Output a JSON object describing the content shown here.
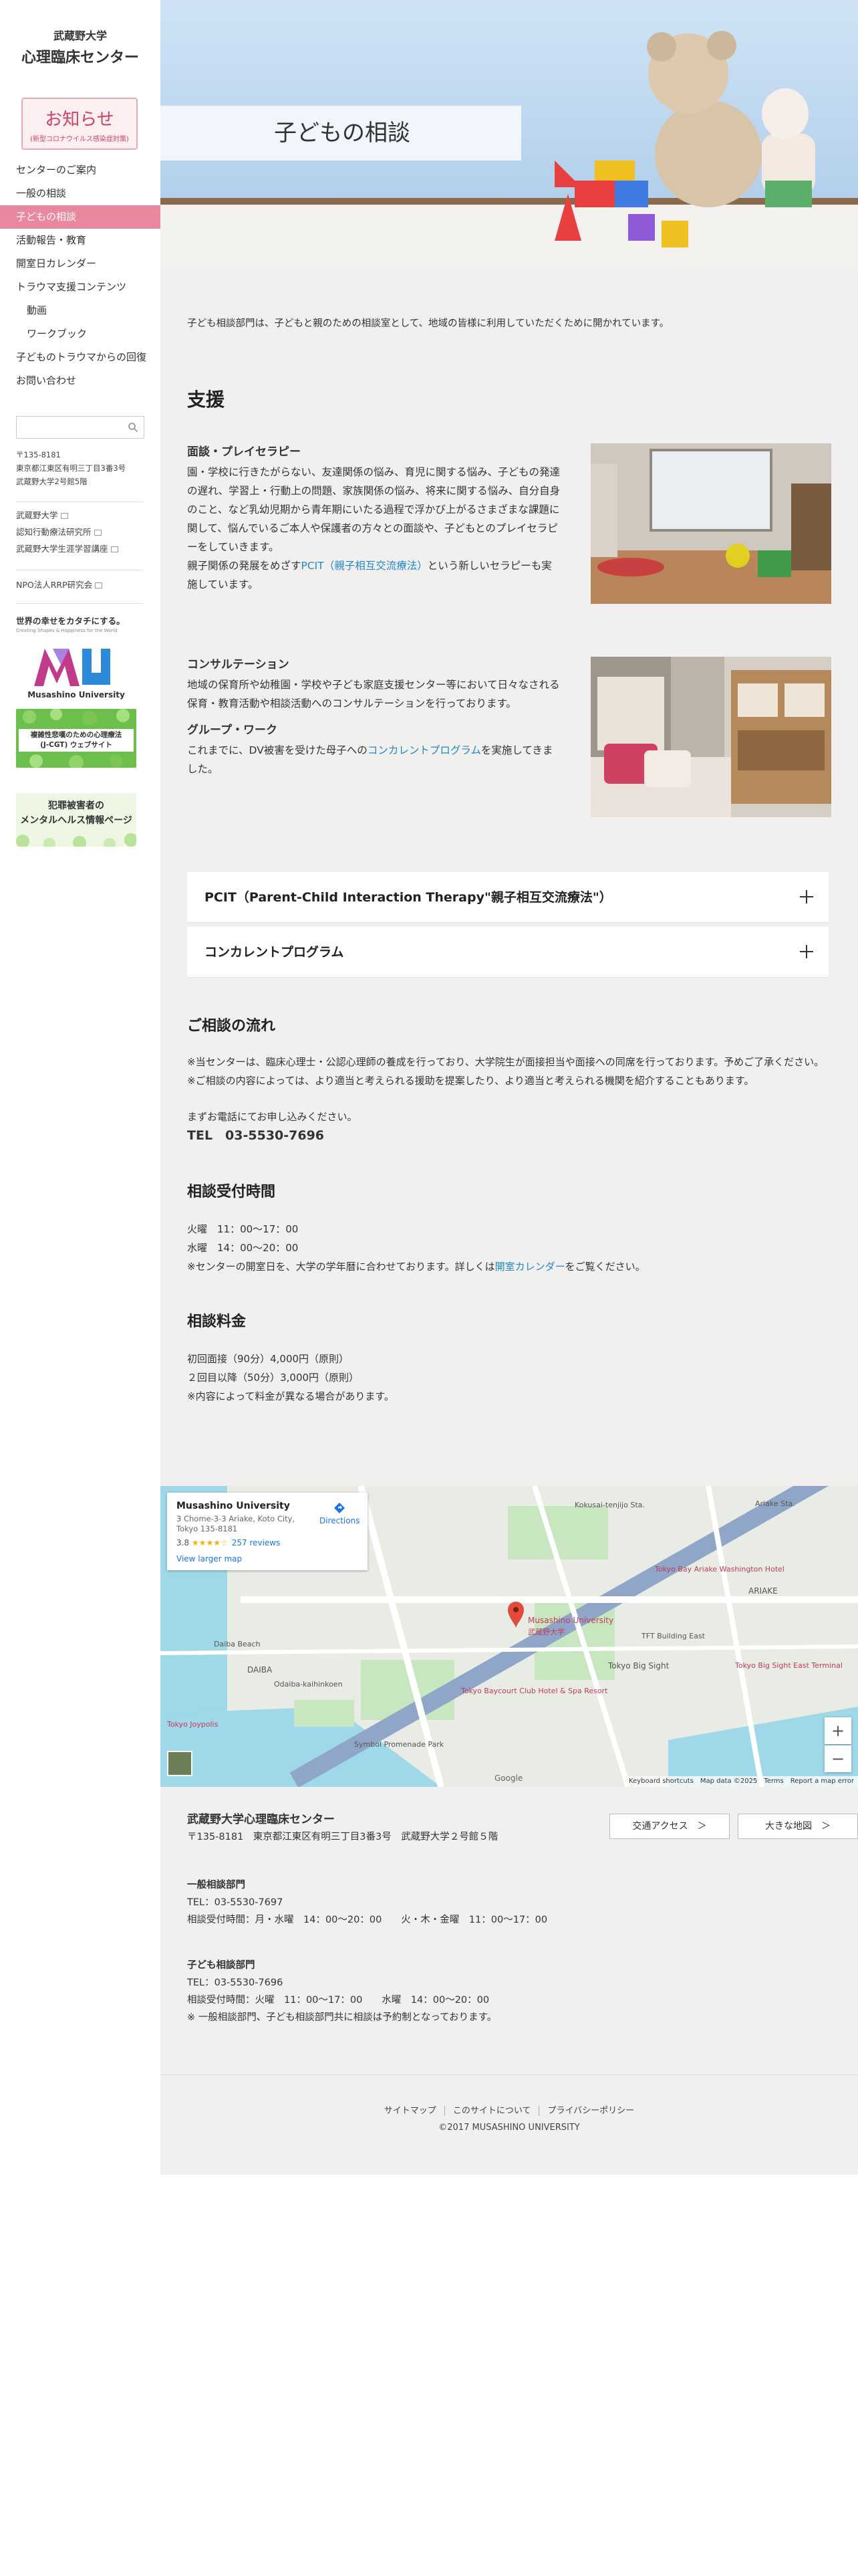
{
  "logo": {
    "university": "武蔵野大学",
    "center": "心理臨床センター"
  },
  "notice": {
    "title": "お知らせ",
    "subtitle": "(新型コロナウイルス感染症対策)"
  },
  "nav": [
    {
      "label": "センターのご案内"
    },
    {
      "label": "一般の相談"
    },
    {
      "label": "子どもの相談"
    },
    {
      "label": "活動報告・教育"
    },
    {
      "label": "開室日カレンダー"
    },
    {
      "label": "トラウマ支援コンテンツ"
    },
    {
      "label": "動画"
    },
    {
      "label": "ワークブック"
    },
    {
      "label": "子どものトラウマからの回復"
    },
    {
      "label": "お問い合わせ"
    }
  ],
  "search": {
    "placeholder": ""
  },
  "sidebar_address": [
    "〒135-8181",
    "東京都江東区有明三丁目3番3号",
    "武蔵野大学2号館5階"
  ],
  "sidebar_links": [
    "武蔵野大学",
    "認知行動療法研究所",
    "武蔵野大学生涯学習講座"
  ],
  "sidebar_links2": [
    "NPO法人RRP研究会"
  ],
  "tagline": {
    "main": "世界の幸せをカタチにする。",
    "sub": "Creating Shapes & Happiness for the World"
  },
  "mu_logo": {
    "text": "Musashino University"
  },
  "banner1": {
    "line1": "複雑性悲嘆のための心理療法",
    "line2": "(J-CGT) ウェブサイト"
  },
  "banner2": {
    "line1": "犯罪被害者の",
    "line2": "メンタルヘルス情報ページ"
  },
  "hero": {
    "title": "子どもの相談"
  },
  "intro": "子ども相談部門は、子どもと親のための相談室として、地域の皆様に利用していただくために開かれています。",
  "support": {
    "heading": "支援",
    "play": {
      "title": "面談・プレイセラピー",
      "body": "園・学校に行きたがらない、友達関係の悩み、育児に関する悩み、子どもの発達の遅れ、学習上・行動上の問題、家族関係の悩み、将来に関する悩み、自分自身のこと、など乳幼児期から青年期にいたる過程で浮かび上がるさまざまな課題に関して、悩んでいるご本人や保護者の方々との面談や、子どもとのプレイセラピーをしていきます。",
      "body2_pre": "親子関係の発展をめざす",
      "body2_link": "PCIT（親子相互交流療法）",
      "body2_post": "という新しいセラピーも実施しています。"
    },
    "consult": {
      "title": "コンサルテーション",
      "body": "地域の保育所や幼稚園・学校や子ども家庭支援センター等において日々なされる保育・教育活動や相談活動へのコンサルテーションを行っております。"
    },
    "group": {
      "title": "グループ・ワーク",
      "body_pre": "これまでに、DV被害を受けた母子への",
      "body_link": "コンカレントプログラム",
      "body_post": "を実施してきました。"
    }
  },
  "accordions": [
    {
      "label": "PCIT（Parent-Child Interaction Therapy\"親子相互交流療法\"）"
    },
    {
      "label": "コンカレントプログラム"
    }
  ],
  "flow": {
    "heading": "ご相談の流れ",
    "line1": "※当センターは、臨床心理士・公認心理師の養成を行っており、大学院生が面接担当や面接への同席を行っております。予めご了承ください。",
    "line2": "※ご相談の内容によっては、より適当と考えられる援助を提案したり、より適当と考えられる機関を紹介することもあります。",
    "line3": "まずお電話にてお申し込みください。",
    "tel": "TEL　03-5530-7696"
  },
  "hours": {
    "heading": "相談受付時間",
    "line1": "火曜　11：00〜17：00",
    "line2": "水曜　14：00〜20：00",
    "line3_pre": "※センターの開室日を、大学の学年暦に合わせております。詳しくは",
    "line3_link": "開室カレンダー",
    "line3_post": "をご覧ください。"
  },
  "fees": {
    "heading": "相談料金",
    "line1": "初回面接（90分）4,000円（原則）",
    "line2": "２回目以降（50分）3,000円（原則）",
    "line3": "※内容によって料金が異なる場合があります。"
  },
  "map": {
    "name": "Musashino University",
    "address": "3 Chome-3-3 Ariake, Koto City, Tokyo 135-8181",
    "rating": "3.8",
    "stars": "★★★★☆",
    "reviews": "257 reviews",
    "directions": "Directions",
    "view_larger": "View larger map",
    "pin_label": "Musashino University",
    "pin_label_jp": "武蔵野大学",
    "labels": [
      "Tokyo Big Sight",
      "Ariake Sta.",
      "Odaiba-kaihinkoen",
      "Tokyo Bay Ariake Washington Hotel",
      "TFT Building East",
      "Tokyo Baycourt Club Hotel & Spa Resort",
      "Symbol Promenade Park",
      "Daiba Beach",
      "DAIBA",
      "ARIAKE",
      "Tokyo Joypolis",
      "Tokyo Big Sight East Terminal",
      "Kokusai-tenjijo Sta."
    ],
    "zoom_in": "+",
    "zoom_out": "−",
    "footer": "Keyboard shortcuts　Map data ©2025　Terms　Report a map error",
    "google": "Google"
  },
  "footer": {
    "name": "武蔵野大学心理臨床センター",
    "address": "〒135-8181　東京都江東区有明三丁目3番3号　武蔵野大学２号館５階",
    "general_title": "一般相談部門",
    "general_tel": "TEL：03-5530-7697",
    "general_hours": "相談受付時間：月・水曜　14：00〜20：00　　火・木・金曜　11：00〜17：00",
    "child_title": "子ども相談部門",
    "child_tel": "TEL：03-5530-7696",
    "child_hours": "相談受付時間：火曜　11：00〜17：00　　水曜　14：00〜20：00",
    "note": "※ 一般相談部門、子ども相談部門共に相談は予約制となっております。",
    "btn_access": "交通アクセス　＞",
    "btn_map": "大きな地図　＞",
    "links": [
      "サイトマップ",
      "このサイトについて",
      "プライバシーポリシー"
    ],
    "copyright": "©2017 MUSASHINO UNIVERSITY"
  },
  "colors": {
    "accent": "#e8879e",
    "link": "#1e88c8",
    "background": "#f2f0ee"
  }
}
